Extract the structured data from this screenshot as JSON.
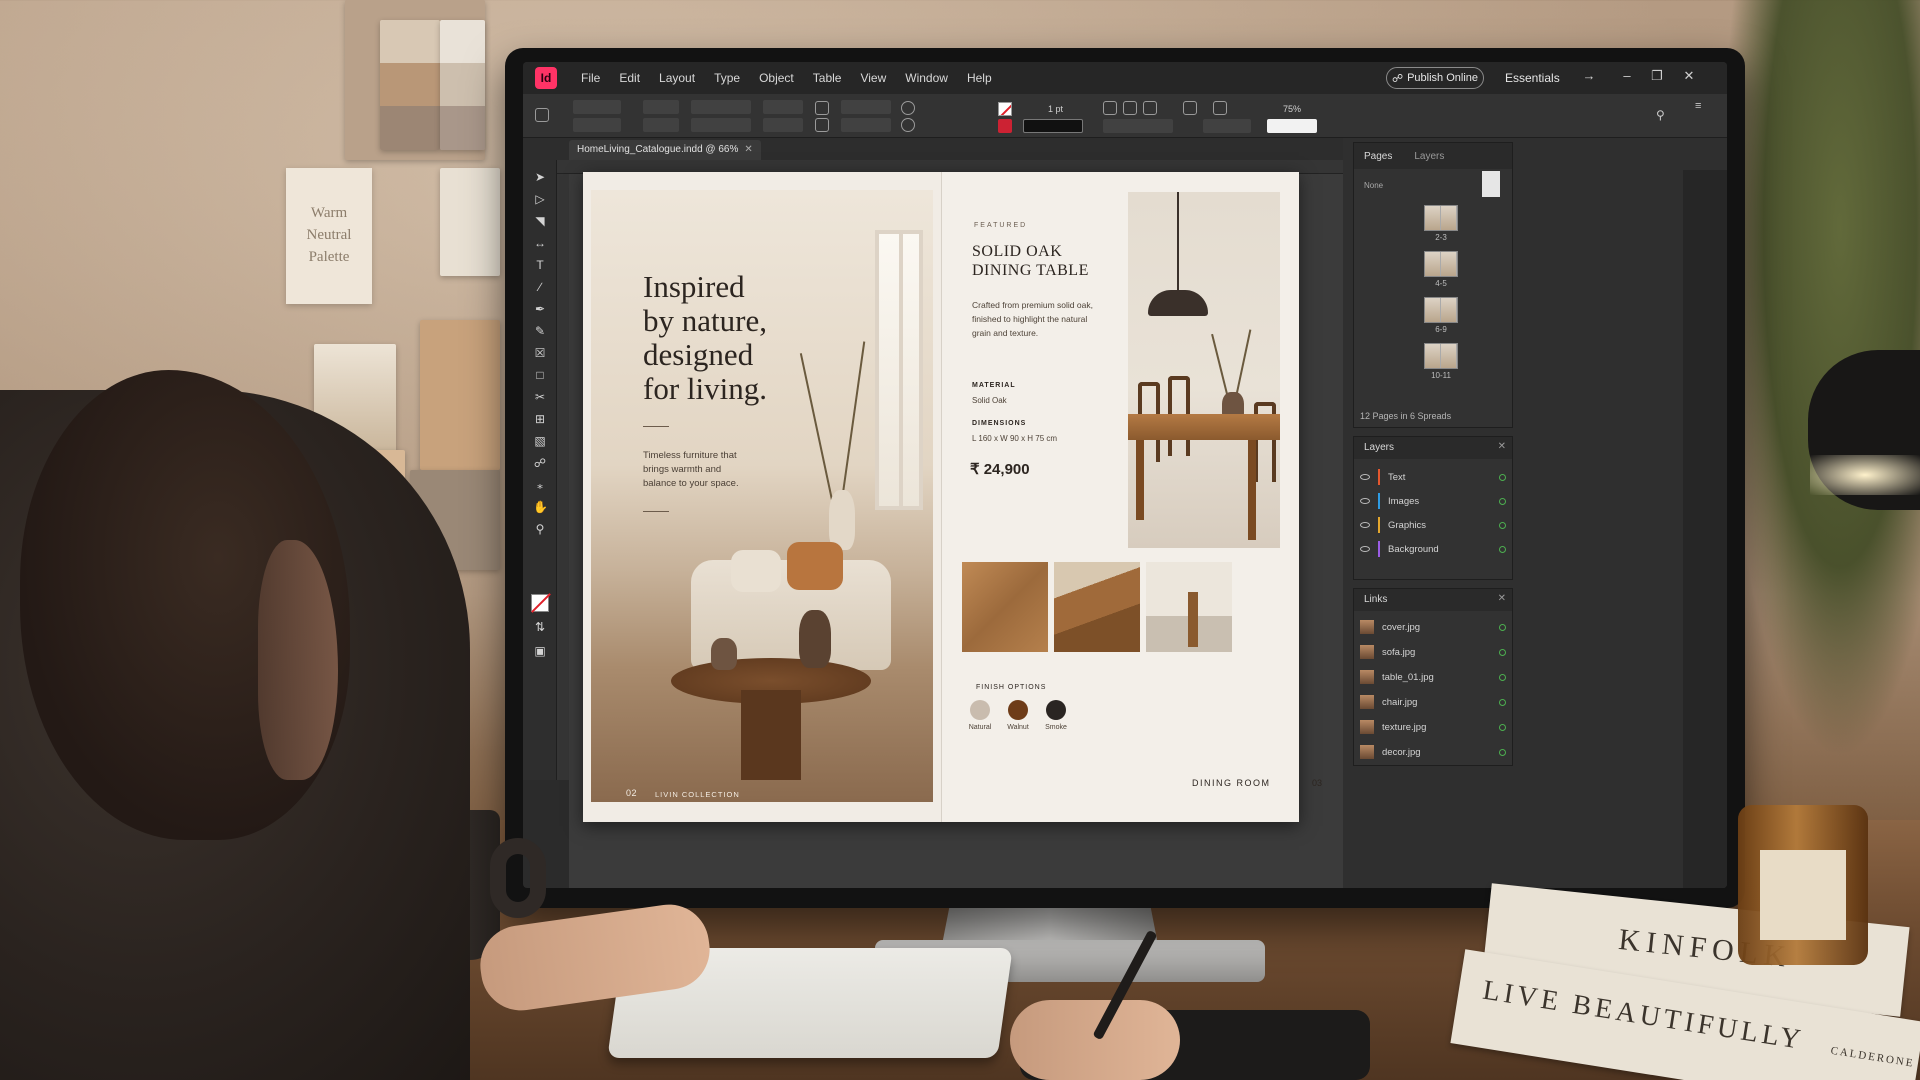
{
  "app": {
    "menu": [
      "File",
      "Edit",
      "Layout",
      "Type",
      "Object",
      "Table",
      "View",
      "Window",
      "Help"
    ],
    "publish_label": "Publish Online",
    "workspace_label": "Essentials",
    "zoom_value": "75%",
    "stroke_weight": "1 pt",
    "doc_tab": "HomeLiving_Catalogue.indd @ 66%"
  },
  "moodboard": {
    "note": [
      "Warm",
      "Neutral",
      "Palette"
    ]
  },
  "spread": {
    "left": {
      "headline": [
        "Inspired",
        "by nature,",
        "designed",
        "for living."
      ],
      "body": "Timeless furniture that brings warmth and balance to your space.",
      "folio": "02",
      "collection": "LIVIN COLLECTION"
    },
    "right": {
      "featured": "FEATURED",
      "title": [
        "SOLID OAK",
        "DINING TABLE"
      ],
      "description": "Crafted from premium solid oak, finished to highlight the natural grain and texture.",
      "material_label": "MATERIAL",
      "material_value": "Solid Oak",
      "dimensions_label": "DIMENSIONS",
      "dimensions_value": "L 160 x W 90 x H 75 cm",
      "price": "₹ 24,900",
      "finish_label": "FINISH OPTIONS",
      "finishes": [
        {
          "name": "Natural",
          "color": "#c9bcae"
        },
        {
          "name": "Walnut",
          "color": "#6e3c18"
        },
        {
          "name": "Smoke",
          "color": "#2a2522"
        }
      ],
      "section": "DINING ROOM",
      "folio": "03"
    }
  },
  "pages_panel": {
    "tabs": [
      "Pages",
      "Layers"
    ],
    "master": "None",
    "spreads": [
      "2-3",
      "4-5",
      "6-9",
      "10-11"
    ],
    "footer": "12 Pages in 6 Spreads"
  },
  "layers_panel": {
    "title": "Layers",
    "layers": [
      {
        "name": "Text",
        "color": "#e4572e"
      },
      {
        "name": "Images",
        "color": "#2e9ce4"
      },
      {
        "name": "Graphics",
        "color": "#e4a72e"
      },
      {
        "name": "Background",
        "color": "#9b5de5"
      }
    ]
  },
  "links_panel": {
    "title": "Links",
    "links": [
      "cover.jpg",
      "sofa.jpg",
      "table_01.jpg",
      "chair.jpg",
      "texture.jpg",
      "decor.jpg"
    ]
  },
  "books": {
    "top": "KINFOLK",
    "bottom": "LIVE BEAUTIFULLY",
    "bottom_small": "CALDERONE"
  }
}
